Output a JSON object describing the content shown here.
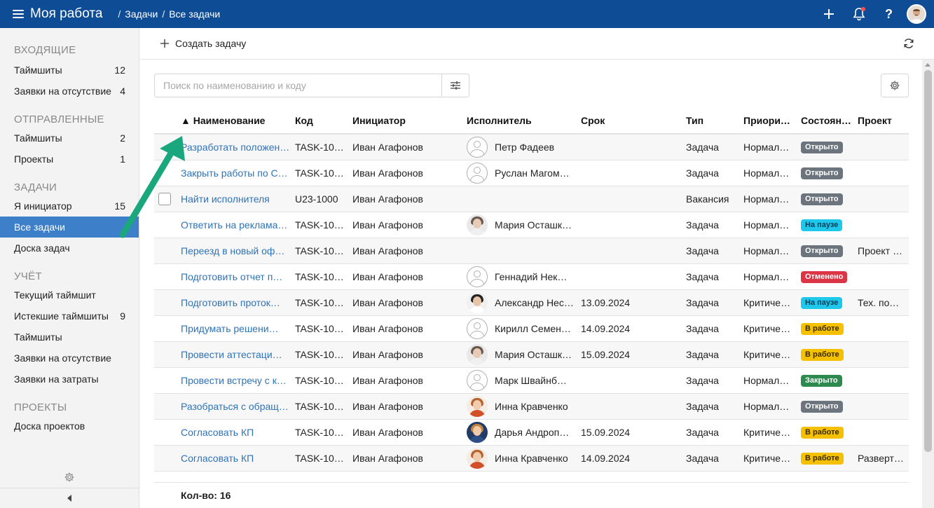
{
  "header": {
    "title": "Моя работа",
    "breadcrumb": [
      "Задачи",
      "Все задачи"
    ],
    "breadcrumb_sep": "/",
    "help_label": "?"
  },
  "sidebar": {
    "sections": [
      {
        "title": "ВХОДЯЩИЕ",
        "items": [
          {
            "label": "Таймшиты",
            "count": "12"
          },
          {
            "label": "Заявки на отсутствие",
            "count": "4"
          }
        ]
      },
      {
        "title": "ОТПРАВЛЕННЫЕ",
        "items": [
          {
            "label": "Таймшиты",
            "count": "2"
          },
          {
            "label": "Проекты",
            "count": "1"
          }
        ]
      },
      {
        "title": "ЗАДАЧИ",
        "items": [
          {
            "label": "Я инициатор",
            "count": "15"
          },
          {
            "label": "Все задачи",
            "count": "",
            "active": true
          },
          {
            "label": "Доска задач",
            "count": ""
          }
        ]
      },
      {
        "title": "УЧЁТ",
        "items": [
          {
            "label": "Текущий таймшит",
            "count": ""
          },
          {
            "label": "Истекшие таймшиты",
            "count": "9"
          },
          {
            "label": "Таймшиты",
            "count": ""
          },
          {
            "label": "Заявки на отсутствие",
            "count": ""
          },
          {
            "label": "Заявки на затраты",
            "count": ""
          }
        ]
      },
      {
        "title": "ПРОЕКТЫ",
        "items": [
          {
            "label": "Доска проектов",
            "count": ""
          }
        ]
      }
    ]
  },
  "toolbar": {
    "create_label": "Создать задачу"
  },
  "search": {
    "placeholder": "Поиск по наименованию и коду",
    "value": ""
  },
  "table": {
    "sort_indicator": "▲",
    "columns": [
      "Наименование",
      "Код",
      "Инициатор",
      "Исполнитель",
      "Срок",
      "Тип",
      "Приори…",
      "Состоян…",
      "Проект"
    ],
    "rows": [
      {
        "name": "Разработать положен…",
        "code": "TASK-10…",
        "initiator": "Иван Агафонов",
        "executor": "Петр Фадеев",
        "avatar": "placeholder",
        "due": "",
        "type": "Задача",
        "priority": "Нормал…",
        "status": "Открыто",
        "status_kind": "open",
        "project": ""
      },
      {
        "name": "Закрыть работы по С…",
        "code": "TASK-10…",
        "initiator": "Иван Агафонов",
        "executor": "Руслан Магом…",
        "avatar": "placeholder",
        "due": "",
        "type": "Задача",
        "priority": "Нормал…",
        "status": "Открыто",
        "status_kind": "open",
        "project": ""
      },
      {
        "name": "Найти исполнителя",
        "code": "U23-1000",
        "initiator": "Иван Агафонов",
        "executor": "",
        "avatar": "none",
        "due": "",
        "type": "Вакансия",
        "priority": "Нормал…",
        "status": "Открыто",
        "status_kind": "open",
        "project": "",
        "checkbox": true
      },
      {
        "name": "Ответить на реклама…",
        "code": "TASK-10…",
        "initiator": "Иван Агафонов",
        "executor": "Мария Осташк…",
        "avatar": "woman1",
        "due": "",
        "type": "Задача",
        "priority": "Нормал…",
        "status": "На паузе",
        "status_kind": "paused",
        "project": ""
      },
      {
        "name": "Переезд в новый оф…",
        "code": "TASK-10…",
        "initiator": "Иван Агафонов",
        "executor": "",
        "avatar": "none",
        "due": "",
        "type": "Задача",
        "priority": "Нормал…",
        "status": "Открыто",
        "status_kind": "open",
        "project": "Проект …"
      },
      {
        "name": "Подготовить отчет п…",
        "code": "TASK-10…",
        "initiator": "Иван Агафонов",
        "executor": "Геннадий Нек…",
        "avatar": "placeholder",
        "due": "",
        "type": "Задача",
        "priority": "Нормал…",
        "status": "Отменено",
        "status_kind": "cancelled",
        "project": ""
      },
      {
        "name": "Подготовить проток…",
        "code": "TASK-10…",
        "initiator": "Иван Агафонов",
        "executor": "Александр Нес…",
        "avatar": "man1",
        "due": "13.09.2024",
        "type": "Задача",
        "priority": "Критиче…",
        "status": "На паузе",
        "status_kind": "paused",
        "project": "Тех. под…"
      },
      {
        "name": "Придумать решени…",
        "code": "TASK-10…",
        "initiator": "Иван Агафонов",
        "executor": "Кирилл Семен…",
        "avatar": "placeholder",
        "due": "14.09.2024",
        "type": "Задача",
        "priority": "Критиче…",
        "status": "В работе",
        "status_kind": "inwork",
        "project": ""
      },
      {
        "name": "Провести аттестаци…",
        "code": "TASK-10…",
        "initiator": "Иван Агафонов",
        "executor": "Мария Осташк…",
        "avatar": "woman1",
        "due": "15.09.2024",
        "type": "Задача",
        "priority": "Критиче…",
        "status": "В работе",
        "status_kind": "inwork",
        "project": ""
      },
      {
        "name": "Провести встречу с к…",
        "code": "TASK-10…",
        "initiator": "Иван Агафонов",
        "executor": "Марк Швайнб…",
        "avatar": "placeholder",
        "due": "",
        "type": "Задача",
        "priority": "Нормал…",
        "status": "Закрыто",
        "status_kind": "closed",
        "project": ""
      },
      {
        "name": "Разобраться с обращ…",
        "code": "TASK-10…",
        "initiator": "Иван Агафонов",
        "executor": "Инна Кравченко",
        "avatar": "woman2",
        "due": "",
        "type": "Задача",
        "priority": "Нормал…",
        "status": "Открыто",
        "status_kind": "open",
        "project": ""
      },
      {
        "name": "Согласовать КП",
        "code": "TASK-10…",
        "initiator": "Иван Агафонов",
        "executor": "Дарья Андроп…",
        "avatar": "woman3",
        "due": "15.09.2024",
        "type": "Задача",
        "priority": "Критиче…",
        "status": "В работе",
        "status_kind": "inwork",
        "project": ""
      },
      {
        "name": "Согласовать КП",
        "code": "TASK-10…",
        "initiator": "Иван Агафонов",
        "executor": "Инна Кравченко",
        "avatar": "woman2",
        "due": "14.09.2024",
        "type": "Задача",
        "priority": "Критиче…",
        "status": "В работе",
        "status_kind": "inwork",
        "project": "Разверт…"
      }
    ]
  },
  "footer": {
    "count_label": "Кол-во: 16"
  },
  "colors": {
    "header_bg": "#0f4c96",
    "active_item": "#3d7fc8",
    "link": "#2e73b8",
    "status_open": "#6c757d",
    "status_paused": "#1ec8ea",
    "status_cancelled": "#dc3545",
    "status_inwork": "#f5c000",
    "status_closed": "#2d8a4e",
    "annotation_arrow": "#1aa77e"
  }
}
